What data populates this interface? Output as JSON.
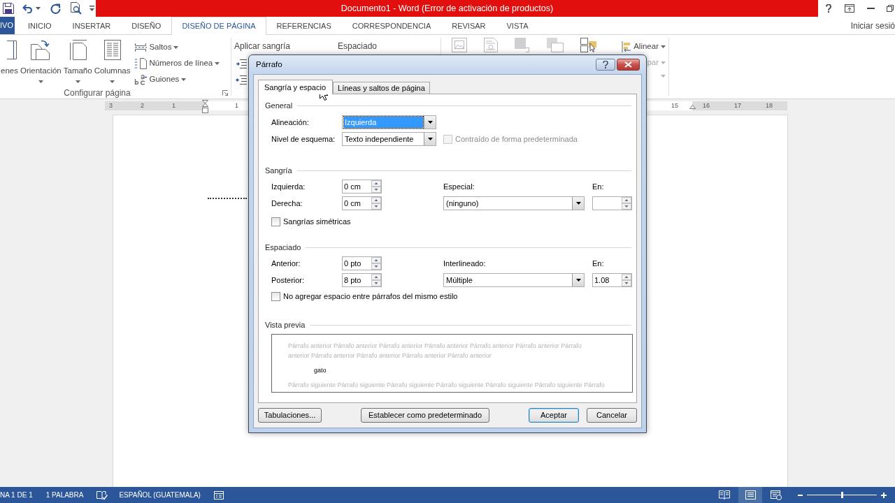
{
  "window": {
    "title": "Documento1 - Word (Error de activación de productos)"
  },
  "ribbon_tabs": [
    {
      "label": "IVO",
      "kind": "file",
      "selected": false
    },
    {
      "label": "INICIO",
      "kind": "tab",
      "selected": false
    },
    {
      "label": "INSERTAR",
      "kind": "tab",
      "selected": false
    },
    {
      "label": "DISEÑO",
      "kind": "tab",
      "selected": false
    },
    {
      "label": "DISEÑO DE PÁGINA",
      "kind": "tab",
      "selected": true
    },
    {
      "label": "REFERENCIAS",
      "kind": "tab",
      "selected": false
    },
    {
      "label": "CORRESPONDENCIA",
      "kind": "tab",
      "selected": false
    },
    {
      "label": "REVISAR",
      "kind": "tab",
      "selected": false
    },
    {
      "label": "VISTA",
      "kind": "tab",
      "selected": false
    }
  ],
  "account": {
    "label": "Iniciar sesió"
  },
  "ribbon": {
    "groups": [
      {
        "kind": "page_setup",
        "label": "Configurar página",
        "launcher": true,
        "large_buttons": [
          {
            "kind": "margins",
            "label": "enes",
            "dropdown": false
          },
          {
            "kind": "orientation",
            "label": "Orientación",
            "dropdown": true
          },
          {
            "kind": "size",
            "label": "Tamaño",
            "dropdown": true
          },
          {
            "kind": "columns",
            "label": "Columnas",
            "dropdown": true
          }
        ],
        "small_buttons": [
          {
            "kind": "breaks",
            "label": "Saltos",
            "dropdown": true
          },
          {
            "kind": "line_numbers",
            "label": "Números de línea",
            "dropdown": true
          },
          {
            "kind": "hyphenation",
            "label": "Guiones",
            "dropdown": true
          }
        ]
      },
      {
        "kind": "paragraph",
        "headings": [
          "Aplicar sangría",
          "Espaciado"
        ]
      },
      {
        "kind": "arrange",
        "small_buttons": [
          {
            "kind": "align",
            "label": "Alinear",
            "dropdown": true,
            "disabled": false
          },
          {
            "kind": "group",
            "label": "par",
            "dropdown": true,
            "disabled": true
          },
          {
            "kind": "rotate",
            "dropdown": true,
            "disabled": true
          }
        ]
      }
    ]
  },
  "ruler": {
    "left_margin_labels": [
      "3",
      "2",
      "1"
    ],
    "left_text_labels": [
      "1"
    ],
    "right_text_labels": [
      "15"
    ],
    "right_margin_labels": [
      "16",
      "17",
      "18"
    ]
  },
  "dialog": {
    "title": "Párrafo",
    "tabs": [
      {
        "label": "Sangría y espacio",
        "selected": true
      },
      {
        "label": "Líneas y saltos de página",
        "selected": false
      }
    ],
    "general": {
      "title": "General",
      "alignment": {
        "label": "Alineación:",
        "value": "Izquierda",
        "focused": true
      },
      "outline_level": {
        "label": "Nivel de esquema:",
        "value": "Texto independiente",
        "focused": false
      },
      "collapsed": {
        "label": "Contraído de forma predeterminada",
        "checked": false,
        "disabled": true
      }
    },
    "indentation": {
      "title": "Sangría",
      "left": {
        "label": "Izquierda:",
        "value": "0 cm"
      },
      "right": {
        "label": "Derecha:",
        "value": "0 cm"
      },
      "special": {
        "label": "Especial:",
        "value": "(ninguno)",
        "focused": false
      },
      "by": {
        "label": "En:"
      },
      "mirror": {
        "label": "Sangrías simétricas",
        "checked": false,
        "disabled": false
      }
    },
    "spacing": {
      "title": "Espaciado",
      "before": {
        "label": "Anterior:",
        "value": "0 pto"
      },
      "after": {
        "label": "Posterior:",
        "value": "8 pto"
      },
      "line_spacing": {
        "label": "Interlineado:",
        "value": "Múltiple",
        "focused": false
      },
      "at": {
        "label": "En:",
        "value": "1.08"
      },
      "dont_add": {
        "label": "No agregar espacio entre párrafos del mismo estilo",
        "checked": false,
        "disabled": false
      }
    },
    "preview": {
      "title": "Vista previa",
      "previous_lines": [
        "Párrafo anterior Párrafo anterior Párrafo anterior Párrafo anterior Párrafo anterior Párrafo anterior Párrafo",
        "anterior Párrafo anterior Párrafo anterior Párrafo anterior Párrafo anterior"
      ],
      "text": "gato",
      "following_lines": [
        "Párrafo siguiente Párrafo siguiente Párrafo siguiente Párrafo siguiente Párrafo siguiente Párrafo siguiente Párrafo"
      ]
    },
    "buttons": [
      {
        "label": "Tabulaciones...",
        "default": false
      },
      {
        "label": "Establecer como predeterminado",
        "default": false
      },
      {
        "label": "Aceptar",
        "default": true
      },
      {
        "label": "Cancelar",
        "default": false
      }
    ]
  },
  "status_bar": {
    "page": "NA 1 DE 1",
    "words": "1 PALABRA",
    "language": "ESPAÑOL (GUATEMALA)",
    "views": [
      {
        "kind": "read",
        "selected": false
      },
      {
        "kind": "print",
        "selected": true
      },
      {
        "kind": "web",
        "selected": false
      }
    ],
    "zoom": {
      "level": 0.5
    }
  }
}
